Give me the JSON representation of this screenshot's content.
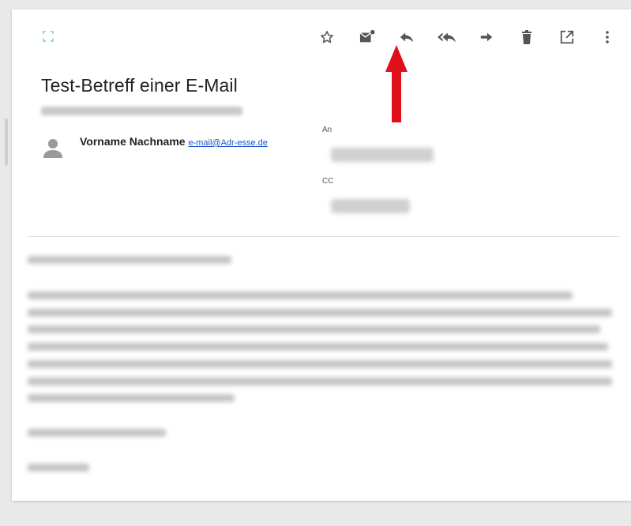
{
  "email": {
    "subject": "Test-Betreff einer E-Mail",
    "sender_name": "Vorname Nachname",
    "sender_email": "e-mail@Adr-esse.de",
    "to_label": "An",
    "cc_label": "CC"
  },
  "toolbar": {
    "buttons": [
      {
        "name": "star-icon"
      },
      {
        "name": "mark-unread-icon"
      },
      {
        "name": "reply-icon"
      },
      {
        "name": "reply-all-icon"
      },
      {
        "name": "forward-icon"
      },
      {
        "name": "delete-icon"
      },
      {
        "name": "open-external-icon"
      },
      {
        "name": "more-options-icon"
      }
    ]
  },
  "colors": {
    "background": "#e9e9ea",
    "card": "#ffffff",
    "icon": "#555555",
    "link": "#1a55c4",
    "highlight_arrow": "#e0101b"
  }
}
